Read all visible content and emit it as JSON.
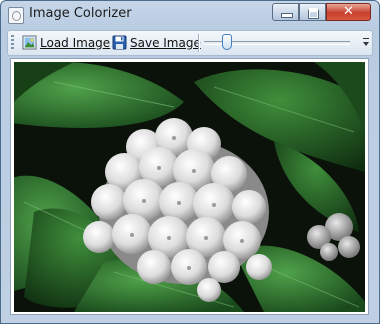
{
  "window": {
    "title": "Image Colorizer"
  },
  "caption_buttons": {
    "minimize": "minimize",
    "maximize": "maximize",
    "close": "✕"
  },
  "toolbar": {
    "load_label": "Load Image",
    "save_label": "Save Image",
    "load_icon": "load-image-icon",
    "save_icon": "floppy-disk-icon",
    "slider_level": 0.12
  },
  "canvas": {
    "content": "hydrangea-photo",
    "colors": {
      "flower": "#e6e6e6",
      "leaf": "#2f7a2f",
      "background": "#0a120a"
    }
  }
}
